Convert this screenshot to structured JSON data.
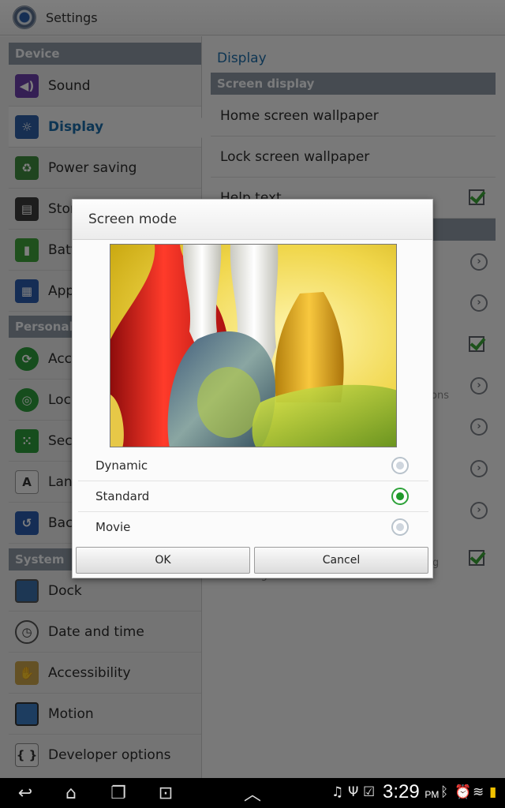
{
  "app": {
    "title": "Settings"
  },
  "left": {
    "sections": [
      "Device",
      "Personal",
      "System"
    ],
    "items": [
      {
        "label": "Sound",
        "icon": "speaker-icon",
        "color": "#6a3fa8",
        "selected": false
      },
      {
        "label": "Display",
        "icon": "brightness-icon",
        "color": "#2f5fa5",
        "selected": true
      },
      {
        "label": "Power saving",
        "icon": "recycle-battery-icon",
        "color": "#3e8a3e",
        "selected": false
      },
      {
        "label": "Stor",
        "icon": "sd-card-icon",
        "color": "#3a3a3a",
        "selected": false
      },
      {
        "label": "Batt",
        "icon": "battery-icon",
        "color": "#3ea03a",
        "selected": false
      },
      {
        "label": "App",
        "icon": "apps-grid-icon",
        "color": "#2a5bab",
        "selected": false
      },
      {
        "label": "Acc",
        "icon": "sync-icon",
        "color": "#2d9a3a",
        "selected": false
      },
      {
        "label": "Loc",
        "icon": "location-icon",
        "color": "#2d9a3a",
        "selected": false
      },
      {
        "label": "Sec",
        "icon": "security-icon",
        "color": "#2d9a3a",
        "selected": false
      },
      {
        "label": "Lan",
        "icon": "language-icon",
        "color": "#dcdcdc",
        "selected": false
      },
      {
        "label": "Bac",
        "icon": "backup-icon",
        "color": "#2a5bab",
        "selected": false
      },
      {
        "label": "Dock",
        "icon": "dock-icon",
        "color": "#3b6ea8",
        "selected": false
      },
      {
        "label": "Date and time",
        "icon": "clock-icon",
        "color": "#dddddd",
        "selected": false
      },
      {
        "label": "Accessibility",
        "icon": "hand-icon",
        "color": "#c9a24a",
        "selected": false
      },
      {
        "label": "Motion",
        "icon": "motion-icon",
        "color": "#3b7ac0",
        "selected": false
      },
      {
        "label": "Developer options",
        "icon": "braces-icon",
        "color": "#e8e8e8",
        "selected": false
      }
    ]
  },
  "right": {
    "title": "Display",
    "subheader": "Screen display",
    "rows": [
      "Home screen wallpaper",
      "Lock screen wallpaper",
      "Help text"
    ],
    "partial_text": [
      "ons",
      "g",
      "ightness"
    ]
  },
  "dialog": {
    "title": "Screen mode",
    "options": [
      {
        "label": "Dynamic",
        "selected": false
      },
      {
        "label": "Standard",
        "selected": true
      },
      {
        "label": "Movie",
        "selected": false
      }
    ],
    "ok_label": "OK",
    "cancel_label": "Cancel"
  },
  "status": {
    "time": "3:29",
    "ampm": "PM",
    "icons": [
      "music-icon",
      "usb-icon",
      "clipboard-check-icon",
      "bluetooth-icon",
      "alarm-icon",
      "wifi-icon",
      "battery-icon"
    ]
  },
  "nav": {
    "icons": [
      "back-icon",
      "home-icon",
      "recent-apps-icon",
      "screenshot-icon",
      "up-caret-icon"
    ]
  },
  "colors": {
    "accent": "#1a6aa6",
    "section_header": "#8c96a3",
    "check_green": "#3aa437"
  }
}
